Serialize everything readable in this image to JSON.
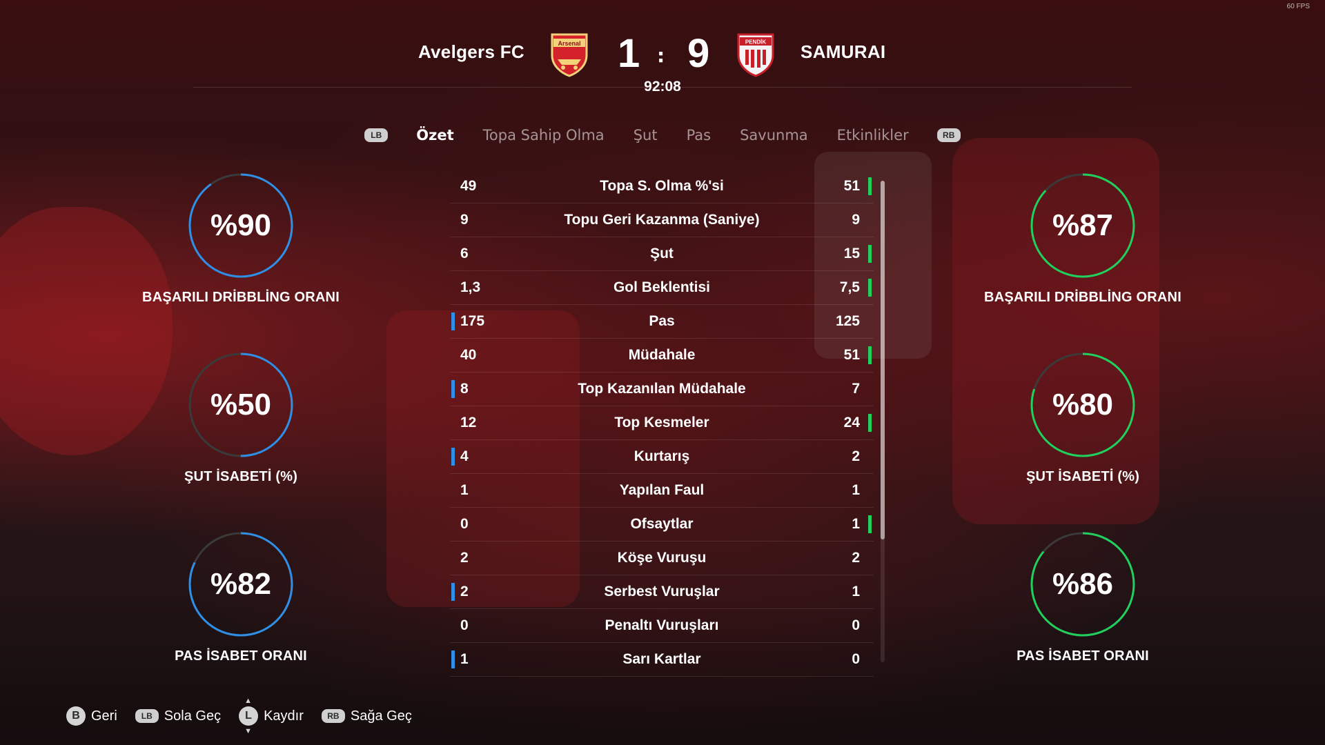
{
  "fps": "60 FPS",
  "match": {
    "home_name": "Avelgers FC",
    "away_name": "SAMURAI",
    "home_crest_text": "Arsenal",
    "away_crest_text": "PENDİK",
    "home_score": "1",
    "away_score": "9",
    "separator": ":",
    "clock": "92:08"
  },
  "tabs": {
    "left_button": "LB",
    "right_button": "RB",
    "items": [
      {
        "label": "Özet",
        "active": true
      },
      {
        "label": "Topa Sahip Olma",
        "active": false
      },
      {
        "label": "Şut",
        "active": false
      },
      {
        "label": "Pas",
        "active": false
      },
      {
        "label": "Savunma",
        "active": false
      },
      {
        "label": "Etkinlikler",
        "active": false
      }
    ]
  },
  "home_rings": [
    {
      "value": "%90",
      "fraction": 0.9,
      "label": "BAŞARILI DRİBBLİNG ORANI"
    },
    {
      "value": "%50",
      "fraction": 0.5,
      "label": "ŞUT İSABETİ (%)"
    },
    {
      "value": "%82",
      "fraction": 0.82,
      "label": "PAS İSABET ORANI"
    }
  ],
  "away_rings": [
    {
      "value": "%87",
      "fraction": 0.87,
      "label": "BAŞARILI DRİBBLİNG ORANI"
    },
    {
      "value": "%80",
      "fraction": 0.8,
      "label": "ŞUT İSABETİ (%)"
    },
    {
      "value": "%86",
      "fraction": 0.86,
      "label": "PAS İSABET ORANI"
    }
  ],
  "stats": [
    {
      "label": "Topa S. Olma %'si",
      "home": "49",
      "away": "51",
      "leader": "away"
    },
    {
      "label": "Topu Geri Kazanma (Saniye)",
      "home": "9",
      "away": "9",
      "leader": "none"
    },
    {
      "label": "Şut",
      "home": "6",
      "away": "15",
      "leader": "away"
    },
    {
      "label": "Gol Beklentisi",
      "home": "1,3",
      "away": "7,5",
      "leader": "away"
    },
    {
      "label": "Pas",
      "home": "175",
      "away": "125",
      "leader": "home"
    },
    {
      "label": "Müdahale",
      "home": "40",
      "away": "51",
      "leader": "away"
    },
    {
      "label": "Top Kazanılan Müdahale",
      "home": "8",
      "away": "7",
      "leader": "home"
    },
    {
      "label": "Top Kesmeler",
      "home": "12",
      "away": "24",
      "leader": "away"
    },
    {
      "label": "Kurtarış",
      "home": "4",
      "away": "2",
      "leader": "home"
    },
    {
      "label": "Yapılan Faul",
      "home": "1",
      "away": "1",
      "leader": "none"
    },
    {
      "label": "Ofsaytlar",
      "home": "0",
      "away": "1",
      "leader": "away"
    },
    {
      "label": "Köşe Vuruşu",
      "home": "2",
      "away": "2",
      "leader": "none"
    },
    {
      "label": "Serbest Vuruşlar",
      "home": "2",
      "away": "1",
      "leader": "home"
    },
    {
      "label": "Penaltı Vuruşları",
      "home": "0",
      "away": "0",
      "leader": "none"
    },
    {
      "label": "Sarı Kartlar",
      "home": "1",
      "away": "0",
      "leader": "home"
    }
  ],
  "footer": [
    {
      "button": "B",
      "label": "Geri",
      "kind": "circle"
    },
    {
      "button": "LB",
      "label": "Sola Geç",
      "kind": "pill"
    },
    {
      "button": "L",
      "label": "Kaydır",
      "kind": "stick"
    },
    {
      "button": "RB",
      "label": "Sağa Geç",
      "kind": "pill"
    }
  ],
  "colors": {
    "home_accent": "#2f8fe6",
    "away_accent": "#21d05c",
    "ring_track": "#3a3a3a"
  }
}
